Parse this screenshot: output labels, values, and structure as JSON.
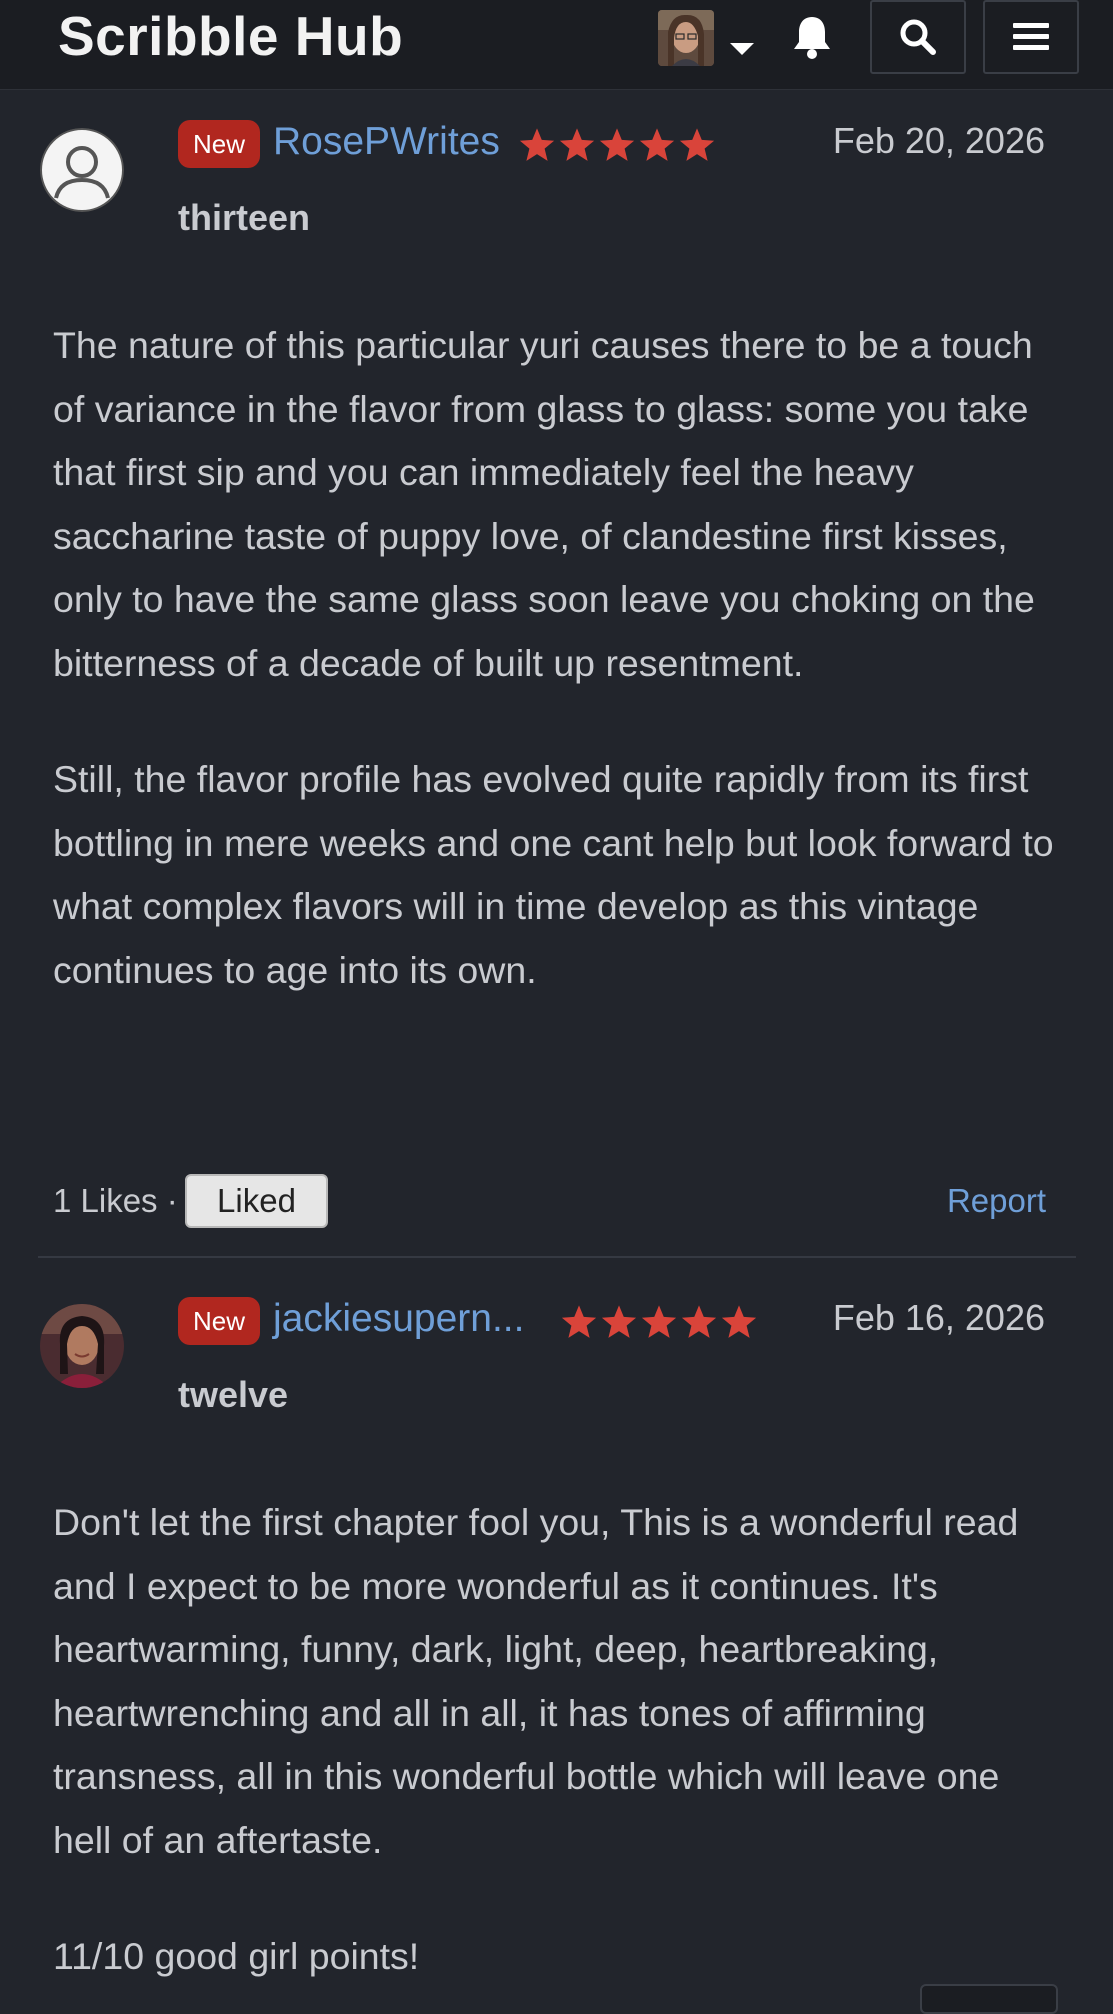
{
  "header": {
    "site_title": "Scribble Hub",
    "icons": [
      "user-avatar",
      "caret-down-icon",
      "bell-icon",
      "search-icon",
      "hamburger-menu-icon"
    ]
  },
  "reviews": [
    {
      "badge": "New",
      "username": "RosePWrites",
      "rating": 5,
      "date": "Feb 20, 2026",
      "chapter": "thirteen",
      "paragraphs": [
        "The nature of this particular yuri causes there to be a touch of variance in the flavor from glass to glass: some you take that first sip and you can immediately feel the heavy  saccharine taste of puppy love, of clandestine first kisses, only to have the same glass soon leave you choking on the bitterness of a decade of built up resentment.",
        "Still, the flavor profile has evolved quite rapidly from its first bottling in mere weeks and one cant help but look forward to what complex flavors will in time develop as this vintage continues to age into its own."
      ],
      "likes_text": "1 Likes ·",
      "liked_label": "Liked",
      "report_label": "Report"
    },
    {
      "badge": "New",
      "username": "jackiesupern...",
      "rating": 5,
      "date": "Feb 16, 2026",
      "chapter": "twelve",
      "paragraphs": [
        "Don't let the first chapter fool you, This is a wonderful read and I expect to be more wonderful as it continues. It's heartwarming, funny, dark, light, deep, heartbreaking, heartwrenching and all in all, it has tones of affirming transness, all in this wonderful bottle which will leave one hell of an aftertaste.",
        "11/10 good girl points!"
      ]
    }
  ],
  "colors": {
    "background": "#22252c",
    "header": "#1b1d22",
    "link": "#6f9fd8",
    "badge": "#b1271f",
    "star": "#d9443a"
  }
}
